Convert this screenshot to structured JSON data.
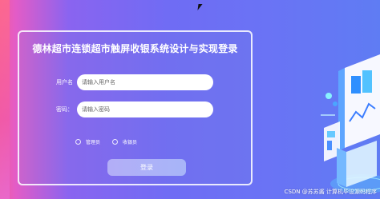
{
  "login": {
    "title": "德林超市连锁超市触屏收银系统设计与实现登录",
    "username_label": "用户名",
    "username_placeholder": "请输入用户名",
    "password_label": "密码：",
    "password_placeholder": "请输入密码",
    "roles": [
      "管理员",
      "收银员"
    ],
    "submit_label": "登录"
  },
  "watermark": "CSDN @苏苏酱  计算机毕设源码程序",
  "colors": {
    "background_accent": "#6f6cf4",
    "button": "#a7b5f8",
    "text": "#ffffff"
  }
}
